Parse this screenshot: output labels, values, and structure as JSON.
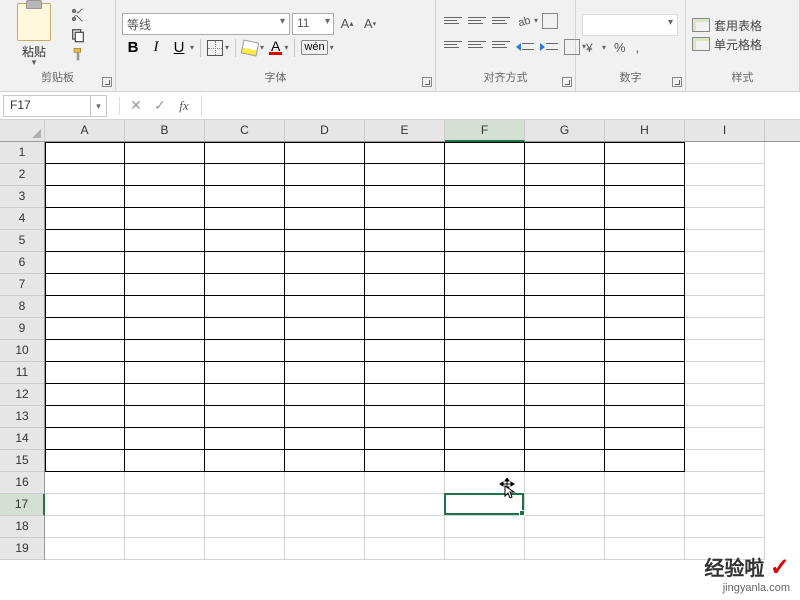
{
  "name_box": "F17",
  "font": {
    "name": "等线",
    "size": "11"
  },
  "ribbon": {
    "clipboard": {
      "label": "剪贴板",
      "paste": "粘贴"
    },
    "font": {
      "label": "字体",
      "bold": "B",
      "italic": "I",
      "underline": "U",
      "A": "A",
      "wen": "wén"
    },
    "alignment": {
      "label": "对齐方式"
    },
    "number": {
      "label": "数字",
      "percent": "%",
      "comma": ","
    },
    "styles": {
      "label": "样式",
      "table_format": "套用表格",
      "cell_format": "单元格格"
    }
  },
  "columns": [
    "A",
    "B",
    "C",
    "D",
    "E",
    "F",
    "G",
    "H",
    "I"
  ],
  "rows": [
    "1",
    "2",
    "3",
    "4",
    "5",
    "6",
    "7",
    "8",
    "9",
    "10",
    "11",
    "12",
    "13",
    "14",
    "15",
    "16",
    "17",
    "18",
    "19"
  ],
  "selected_col_index": 5,
  "selected_row_index": 16,
  "bordered": {
    "cols": 8,
    "rows": 15
  },
  "watermark": {
    "line1": "经验啦",
    "line2": "jingyanla.com"
  }
}
